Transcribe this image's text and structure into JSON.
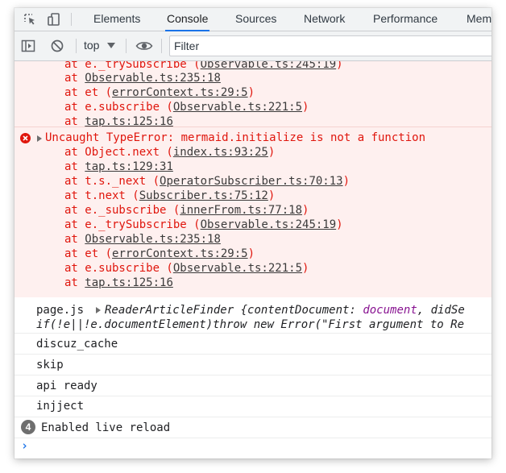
{
  "tabs": [
    {
      "label": "Elements"
    },
    {
      "label": "Console"
    },
    {
      "label": "Sources"
    },
    {
      "label": "Network"
    },
    {
      "label": "Performance"
    },
    {
      "label": "Mem"
    }
  ],
  "toolbar": {
    "context": "top",
    "filter_placeholder": "Filter"
  },
  "error_block_1": {
    "frames": [
      {
        "fn": "at e._trySubscribe (",
        "loc": "Observable.ts:245:19",
        "end": ")"
      },
      {
        "fn": "at ",
        "loc": "Observable.ts:235:18",
        "end": ""
      },
      {
        "fn": "at et (",
        "loc": "errorContext.ts:29:5",
        "end": ")"
      },
      {
        "fn": "at e.subscribe (",
        "loc": "Observable.ts:221:5",
        "end": ")"
      },
      {
        "fn": "at ",
        "loc": "tap.ts:125:16",
        "end": ""
      }
    ]
  },
  "error_block_2": {
    "message": "Uncaught TypeError: mermaid.initialize is not a function",
    "frames": [
      {
        "fn": "at Object.next (",
        "loc": "index.ts:93:25",
        "end": ")"
      },
      {
        "fn": "at ",
        "loc": "tap.ts:129:31",
        "end": ""
      },
      {
        "fn": "at t.s._next (",
        "loc": "OperatorSubscriber.ts:70:13",
        "end": ")"
      },
      {
        "fn": "at t.next (",
        "loc": "Subscriber.ts:75:12",
        "end": ")"
      },
      {
        "fn": "at e._subscribe (",
        "loc": "innerFrom.ts:77:18",
        "end": ")"
      },
      {
        "fn": "at e._trySubscribe (",
        "loc": "Observable.ts:245:19",
        "end": ")"
      },
      {
        "fn": "at ",
        "loc": "Observable.ts:235:18",
        "end": ""
      },
      {
        "fn": "at et (",
        "loc": "errorContext.ts:29:5",
        "end": ")"
      },
      {
        "fn": "at e.subscribe (",
        "loc": "Observable.ts:221:5",
        "end": ")"
      },
      {
        "fn": "at ",
        "loc": "tap.ts:125:16",
        "end": ""
      }
    ]
  },
  "logs": {
    "page_source": "page.js",
    "object_name": "ReaderArticleFinder",
    "object_preview_a": " {contentDocument: ",
    "object_preview_kw": "document",
    "object_preview_b": ", didSe",
    "object_line2": "if(!e||!e.documentElement)throw new Error(\"First argument to Re",
    "simple": [
      "discuz_cache",
      "skip",
      "api ready",
      "injject"
    ],
    "repeat_count": "4",
    "repeat_message": "Enabled live reload"
  },
  "colors": {
    "error_text": "#e0160d",
    "error_bg": "#fef0ef",
    "accent": "#1a73e8"
  }
}
